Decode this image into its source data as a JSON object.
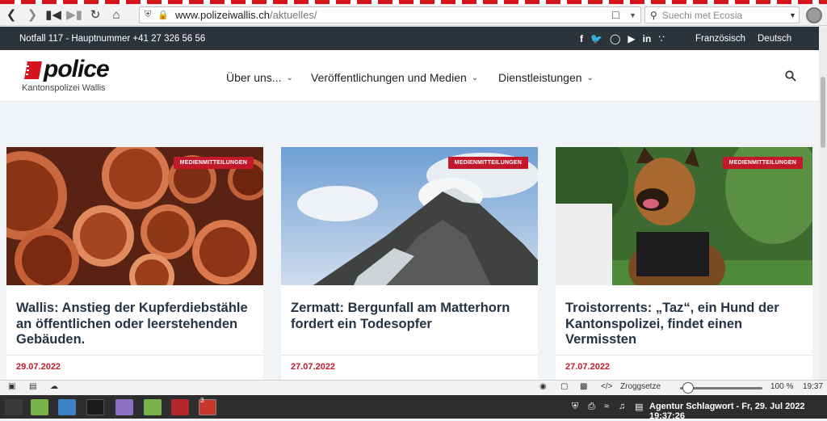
{
  "browser": {
    "url_host": "www.polizeiwallis.ch",
    "url_path": "/aktuelles/",
    "search_placeholder": "Suechi met Ecosia",
    "zoom_label": "Zroggsetze",
    "zoom_value": "100 %",
    "clock": "19:37",
    "zoom_level": 1.0
  },
  "topbar": {
    "emergency": "Notfall 117 - Hauptnummer +41 27 326 56 56",
    "social_icons": [
      "facebook-icon",
      "twitter-icon",
      "instagram-icon",
      "youtube-icon",
      "linkedin-icon",
      "rss-icon"
    ],
    "lang_fr": "Französisch",
    "lang_de": "Deutsch"
  },
  "header": {
    "logo_word": "police",
    "logo_sub": "Kantonspolizei Wallis",
    "nav": [
      {
        "label": "Über uns..."
      },
      {
        "label": "Veröffentlichungen und Medien"
      },
      {
        "label": "Dienstleistungen"
      }
    ]
  },
  "cards": [
    {
      "badge": "MEDIENMITTEILUNGEN",
      "title": "Wallis: Anstieg der Kupferdiebstähle an öffentlichen oder leerstehenden Gebäuden.",
      "date": "29.07.2022"
    },
    {
      "badge": "MEDIENMITTEILUNGEN",
      "title": "Zermatt: Bergunfall am Matterhorn fordert ein Todesopfer",
      "date": "27.07.2022"
    },
    {
      "badge": "MEDIENMITTEILUNGEN",
      "title": "Troistorrents: „Taz“, ein Hund der Kantonspolizei, findet einen Vermissten",
      "date": "27.07.2022"
    }
  ],
  "taskbar": {
    "badge_count": "3",
    "tray_text": "Agentur Schlagwort - Fr, 29. Jul 2022 19:37:26"
  },
  "colors": {
    "accent": "#c2182a",
    "topbar": "#2b333b",
    "title": "#243444"
  }
}
